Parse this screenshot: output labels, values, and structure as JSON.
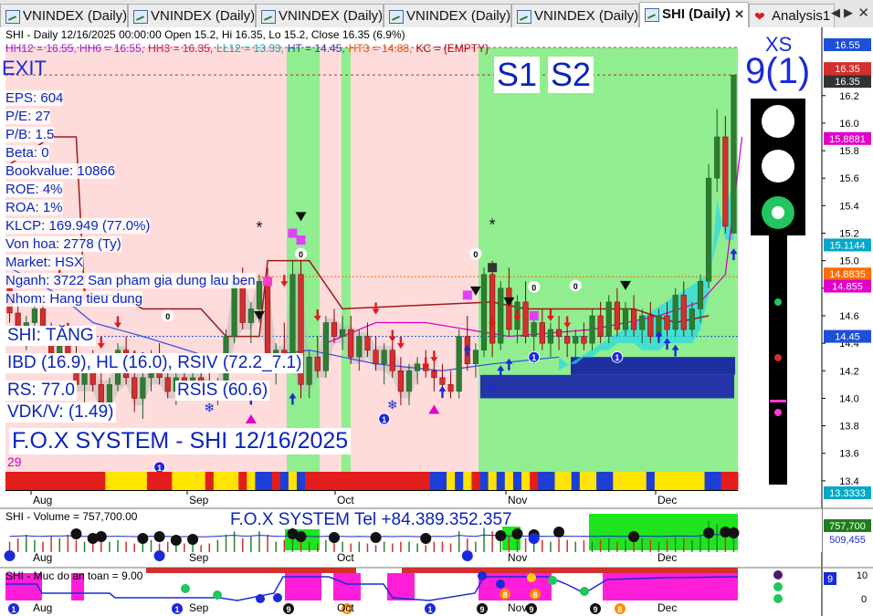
{
  "tabs": [
    {
      "label": "VNINDEX (Daily)",
      "active": false
    },
    {
      "label": "VNINDEX (Daily)",
      "active": false
    },
    {
      "label": "VNINDEX (Daily)",
      "active": false
    },
    {
      "label": "VNINDEX (Daily)",
      "active": false
    },
    {
      "label": "VNINDEX (Daily)",
      "active": false
    },
    {
      "label": "SHI (Daily)",
      "active": true
    },
    {
      "label": "Analysis1",
      "active": false
    }
  ],
  "header": {
    "line1": "SHI - Daily 12/16/2025 00:00:00 Open 15.2, Hi 16.35, Lo 15.2, Close 16.35 (6.9%)",
    "line2_parts": [
      {
        "text": "HH12 = 16.55, HH6 = 16.55,",
        "color": "#9b1fd0"
      },
      {
        "text": "HH3 = 16.35,",
        "color": "#c2185b"
      },
      {
        "text": "LL12 = 13.33,",
        "color": "#00aaaa"
      },
      {
        "text": "HT = 14.45,",
        "color": "#1a3fb5"
      },
      {
        "text": "HT3 = 14.88,",
        "color": "#e65100"
      },
      {
        "text": "KC = {EMPTY}",
        "color": "#b00000"
      }
    ]
  },
  "labels": {
    "exit": "EXIT",
    "s1": "S1",
    "s2": "S2",
    "xs": "XS",
    "xs_count": "9(1)",
    "tang": "SHI: TĂNG",
    "ibd": "IBD (16.9), HL (16.0), RSIV (72.2_7.1)",
    "rsis": "RSIS (60.6)",
    "rs": "RS: 77.0",
    "vdkv": "VDK/V:  (1.49)",
    "fox": "F.O.X SYSTEM - SHI 12/16/2025",
    "count29": "29"
  },
  "fundamentals": [
    "EPS: 604",
    "P/E: 27",
    "P/B: 1.5",
    "Beta: 0",
    "Bookvalue: 10866",
    "ROE: 4%",
    "ROA: 1%",
    "KLCP: 169.949 (77.0%)",
    "Von hoa: 2778 (Ty)",
    "Market: HSX",
    "Nganh: 3722 San pham gia dung lau ben",
    "Nhom: Hang tieu dung"
  ],
  "volume_panel": {
    "title": "SHI - Volume = 757,700.00",
    "contact": "F.O.X SYSTEM Tel +84.389.352.357",
    "tags": [
      "757,700",
      "509,455"
    ]
  },
  "safety_panel": {
    "title": "SHI - Muc do an toan = 9.00",
    "tag": "9",
    "axis_labels": [
      "10",
      "0"
    ]
  },
  "colors": {
    "up": "#2e7d32",
    "down": "#d32f2f",
    "green_zone": "#90ee90",
    "pink_zone": "#ffdcdc",
    "navy": "#2535a8"
  },
  "chart_data": {
    "type": "candlestick",
    "title": "SHI - Daily 12/16/2025",
    "x_months": [
      "Aug",
      "Sep",
      "Oct",
      "Nov",
      "Dec"
    ],
    "ylim": [
      13.333,
      16.55
    ],
    "y_ticks": [
      13.4,
      13.6,
      13.8,
      14.0,
      14.2,
      14.4,
      14.6,
      14.8,
      15.0,
      15.2,
      15.4,
      15.6,
      15.8,
      16.0,
      16.2
    ],
    "price_tags": [
      {
        "label": "16.55",
        "value": 16.55,
        "color": "#1d4fd8"
      },
      {
        "label": "16.35",
        "value": 16.35,
        "color": "#d32f2f"
      },
      {
        "label": "16.35",
        "value": 16.35,
        "color": "#333333"
      },
      {
        "label": "15.8881",
        "value": 15.8881,
        "color": "#e000c8"
      },
      {
        "label": "15.1144",
        "value": 15.1144,
        "color": "#00a9c8"
      },
      {
        "label": "14.8835",
        "value": 14.8835,
        "color": "#ff6a00"
      },
      {
        "label": "14.855",
        "value": 14.855,
        "color": "#e000c8"
      },
      {
        "label": "14.45",
        "value": 14.45,
        "color": "#1d4fd8"
      },
      {
        "label": "13.3333",
        "value": 13.3333,
        "color": "#00a9c8"
      }
    ],
    "candles": [
      [
        14.8,
        14.9,
        14.55,
        14.62
      ],
      [
        14.62,
        14.7,
        14.4,
        14.45
      ],
      [
        14.45,
        14.6,
        14.35,
        14.55
      ],
      [
        14.55,
        14.7,
        14.5,
        14.65
      ],
      [
        14.65,
        14.75,
        14.4,
        14.45
      ],
      [
        14.45,
        14.55,
        14.2,
        14.3
      ],
      [
        14.3,
        14.5,
        14.25,
        14.45
      ],
      [
        14.45,
        14.55,
        14.2,
        14.25
      ],
      [
        14.25,
        14.4,
        14.0,
        14.1
      ],
      [
        14.1,
        14.3,
        13.95,
        14.2
      ],
      [
        14.2,
        14.35,
        14.05,
        14.1
      ],
      [
        14.1,
        14.2,
        13.85,
        13.95
      ],
      [
        13.95,
        14.15,
        13.9,
        14.1
      ],
      [
        14.1,
        14.4,
        14.05,
        14.35
      ],
      [
        14.35,
        14.45,
        14.1,
        14.15
      ],
      [
        14.15,
        14.25,
        13.9,
        14.0
      ],
      [
        14.0,
        14.2,
        13.85,
        14.15
      ],
      [
        14.15,
        14.35,
        14.05,
        14.3
      ],
      [
        14.3,
        14.4,
        14.1,
        14.15
      ],
      [
        14.15,
        14.25,
        14.0,
        14.05
      ],
      [
        14.05,
        14.2,
        13.95,
        14.15
      ],
      [
        14.15,
        14.25,
        14.05,
        14.1
      ],
      [
        14.1,
        14.2,
        14.0,
        14.15
      ],
      [
        14.15,
        14.3,
        14.05,
        14.1
      ],
      [
        14.1,
        14.2,
        14.0,
        14.05
      ],
      [
        14.05,
        14.15,
        13.95,
        14.1
      ],
      [
        14.1,
        14.5,
        14.05,
        14.45
      ],
      [
        14.45,
        14.9,
        14.4,
        14.85
      ],
      [
        14.85,
        14.95,
        14.5,
        14.55
      ],
      [
        14.55,
        14.7,
        14.4,
        14.65
      ],
      [
        14.65,
        14.9,
        14.55,
        14.85
      ],
      [
        14.85,
        14.95,
        14.2,
        14.25
      ],
      [
        14.25,
        14.4,
        14.1,
        14.35
      ],
      [
        14.35,
        14.55,
        14.2,
        14.25
      ],
      [
        14.25,
        15.0,
        14.2,
        14.9
      ],
      [
        14.9,
        15.05,
        14.0,
        14.1
      ],
      [
        14.1,
        14.35,
        14.0,
        14.3
      ],
      [
        14.3,
        14.45,
        14.15,
        14.2
      ],
      [
        14.2,
        14.6,
        14.15,
        14.55
      ],
      [
        14.55,
        14.65,
        14.4,
        14.45
      ],
      [
        14.45,
        14.6,
        14.35,
        14.5
      ],
      [
        14.5,
        14.6,
        14.25,
        14.3
      ],
      [
        14.3,
        14.5,
        14.2,
        14.45
      ],
      [
        14.45,
        14.55,
        14.3,
        14.35
      ],
      [
        14.35,
        14.45,
        14.2,
        14.25
      ],
      [
        14.25,
        14.4,
        14.1,
        14.35
      ],
      [
        14.35,
        14.45,
        14.15,
        14.2
      ],
      [
        14.2,
        14.3,
        13.95,
        14.05
      ],
      [
        14.05,
        14.25,
        13.95,
        14.2
      ],
      [
        14.2,
        14.3,
        14.1,
        14.25
      ],
      [
        14.25,
        14.35,
        14.15,
        14.2
      ],
      [
        14.2,
        14.3,
        14.05,
        14.15
      ],
      [
        14.15,
        14.25,
        14.0,
        14.1
      ],
      [
        14.1,
        14.2,
        14.0,
        14.05
      ],
      [
        14.05,
        14.5,
        14.0,
        14.45
      ],
      [
        14.45,
        14.6,
        14.2,
        14.25
      ],
      [
        14.25,
        14.4,
        14.15,
        14.35
      ],
      [
        14.35,
        14.95,
        14.3,
        14.9
      ],
      [
        14.9,
        15.0,
        14.3,
        14.4
      ],
      [
        14.4,
        14.85,
        14.35,
        14.8
      ],
      [
        14.8,
        14.95,
        14.45,
        14.5
      ],
      [
        14.5,
        14.75,
        14.4,
        14.7
      ],
      [
        14.7,
        14.85,
        14.4,
        14.45
      ],
      [
        14.45,
        14.6,
        14.25,
        14.55
      ],
      [
        14.55,
        14.65,
        14.35,
        14.4
      ],
      [
        14.4,
        14.55,
        14.3,
        14.5
      ],
      [
        14.5,
        14.6,
        14.35,
        14.45
      ],
      [
        14.45,
        14.55,
        14.3,
        14.4
      ],
      [
        14.4,
        14.5,
        14.3,
        14.45
      ],
      [
        14.45,
        14.55,
        14.35,
        14.4
      ],
      [
        14.4,
        14.65,
        14.35,
        14.6
      ],
      [
        14.6,
        14.7,
        14.4,
        14.45
      ],
      [
        14.45,
        14.75,
        14.4,
        14.7
      ],
      [
        14.7,
        14.8,
        14.45,
        14.5
      ],
      [
        14.5,
        14.7,
        14.45,
        14.65
      ],
      [
        14.65,
        14.75,
        14.45,
        14.5
      ],
      [
        14.5,
        14.65,
        14.4,
        14.6
      ],
      [
        14.6,
        14.7,
        14.4,
        14.45
      ],
      [
        14.45,
        14.65,
        14.4,
        14.6
      ],
      [
        14.6,
        14.7,
        14.45,
        14.5
      ],
      [
        14.5,
        14.8,
        14.45,
        14.75
      ],
      [
        14.75,
        14.85,
        14.45,
        14.5
      ],
      [
        14.5,
        14.7,
        14.45,
        14.65
      ],
      [
        14.65,
        14.9,
        14.55,
        14.85
      ],
      [
        14.85,
        15.7,
        14.8,
        15.6
      ],
      [
        15.6,
        16.1,
        15.5,
        15.9
      ],
      [
        15.9,
        16.05,
        15.2,
        15.25
      ],
      [
        15.2,
        16.35,
        15.2,
        16.35
      ]
    ]
  }
}
